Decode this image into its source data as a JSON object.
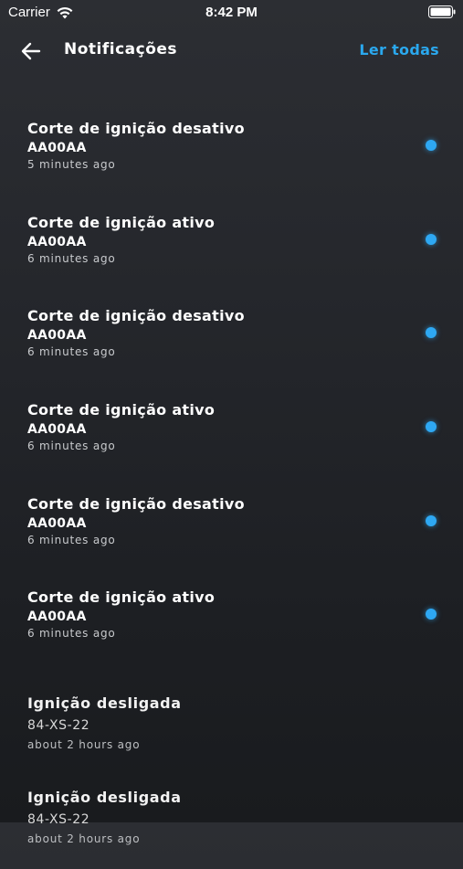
{
  "status_bar": {
    "carrier": "Carrier",
    "time": "8:42 PM"
  },
  "header": {
    "title": "Notificações",
    "read_all": "Ler todas"
  },
  "colors": {
    "accent": "#2aa8ee",
    "unread_dot": "#2ea8f3"
  },
  "notifications": [
    {
      "title": "Corte de ignição desativo",
      "plate": "AA00AA",
      "time": "5 minutes ago",
      "unread": true
    },
    {
      "title": "Corte de ignição ativo",
      "plate": "AA00AA",
      "time": "6 minutes ago",
      "unread": true
    },
    {
      "title": "Corte de ignição desativo",
      "plate": "AA00AA",
      "time": "6 minutes ago",
      "unread": true
    },
    {
      "title": "Corte de ignição ativo",
      "plate": "AA00AA",
      "time": "6 minutes ago",
      "unread": true
    },
    {
      "title": "Corte de ignição desativo",
      "plate": "AA00AA",
      "time": "6 minutes ago",
      "unread": true
    },
    {
      "title": "Corte de ignição ativo",
      "plate": "AA00AA",
      "time": "6 minutes ago",
      "unread": true
    },
    {
      "title": "Ignição desligada",
      "plate": "84-XS-22",
      "time": "about 2 hours ago",
      "unread": false
    },
    {
      "title": "Ignição desligada",
      "plate": "84-XS-22",
      "time": "about 2 hours ago",
      "unread": false
    }
  ]
}
